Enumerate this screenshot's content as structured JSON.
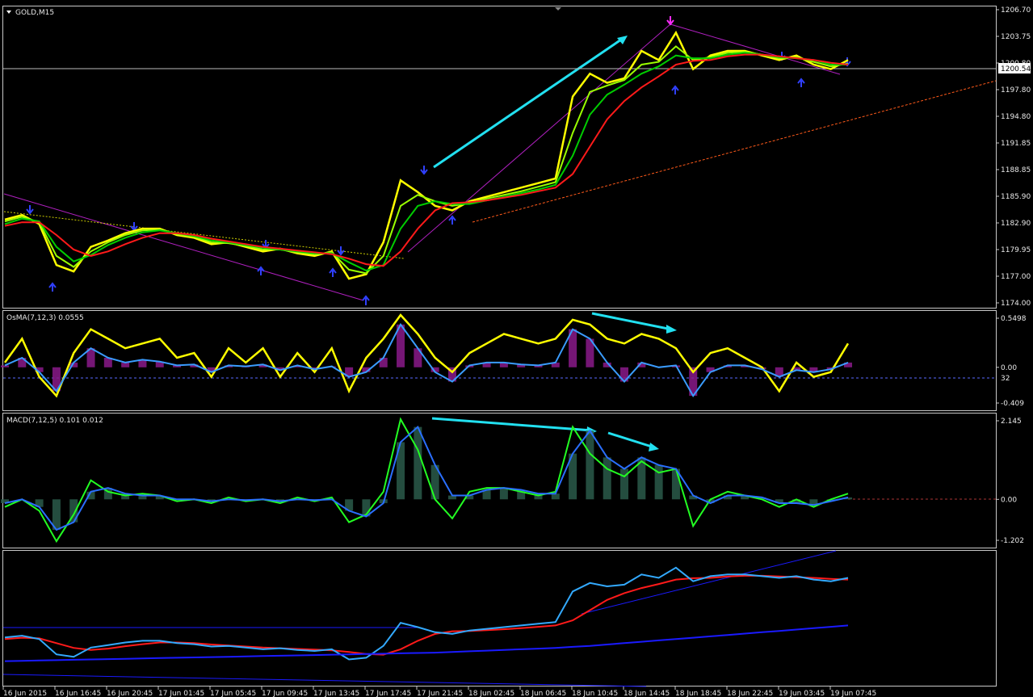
{
  "chart_data": {
    "type": "line",
    "panels": [
      {
        "id": "price",
        "label": "GOLD,M15",
        "ylim": [
          1174.0,
          1206.7
        ],
        "ticks": [
          "1206.70",
          "1203.75",
          "1200.80",
          "1197.80",
          "1194.80",
          "1191.85",
          "1188.85",
          "1185.90",
          "1182.90",
          "1179.95",
          "1177.00",
          "1174.00"
        ],
        "current_price": "1200.54",
        "series": [
          {
            "color": "#ffff00",
            "values": [
              1183.5,
              1184.0,
              1183.0,
              1178.5,
              1177.8,
              1180.5,
              1181.2,
              1182.0,
              1182.5,
              1182.5,
              1181.8,
              1181.5,
              1180.8,
              1181.0,
              1180.5,
              1180.0,
              1180.3,
              1179.8,
              1179.5,
              1180.0,
              1177.0,
              1177.5,
              1181.0,
              1187.8,
              1186.5,
              1185.0,
              1184.5,
              1185.5,
              1186.0,
              1186.5,
              1187.0,
              1187.5,
              1188.0,
              1197.0,
              1199.5,
              1198.5,
              1199.0,
              1202.0,
              1201.0,
              1204.0,
              1200.0,
              1201.5,
              1202.0,
              1202.0,
              1201.5,
              1201.0,
              1201.5,
              1200.5,
              1200.0,
              1201.0
            ]
          },
          {
            "color": "#9aff00",
            "values": [
              1183.3,
              1183.8,
              1183.2,
              1179.5,
              1178.3,
              1180.0,
              1181.0,
              1181.8,
              1182.3,
              1182.4,
              1181.9,
              1181.6,
              1181.0,
              1180.9,
              1180.6,
              1180.2,
              1180.2,
              1179.9,
              1179.7,
              1179.9,
              1178.0,
              1177.6,
              1179.5,
              1185.0,
              1186.2,
              1185.5,
              1185.0,
              1185.3,
              1185.8,
              1186.2,
              1186.6,
              1187.1,
              1187.6,
              1193.0,
              1197.5,
              1198.2,
              1198.8,
              1200.5,
              1200.8,
              1202.5,
              1201.0,
              1201.3,
              1201.8,
              1201.9,
              1201.6,
              1201.2,
              1201.3,
              1200.8,
              1200.3,
              1200.6
            ]
          },
          {
            "color": "#00cc00",
            "values": [
              1183.0,
              1183.6,
              1183.3,
              1180.5,
              1178.9,
              1179.6,
              1180.7,
              1181.5,
              1182.1,
              1182.3,
              1182.0,
              1181.7,
              1181.2,
              1181.0,
              1180.7,
              1180.4,
              1180.2,
              1180.0,
              1179.8,
              1179.8,
              1178.8,
              1177.9,
              1178.5,
              1182.5,
              1185.0,
              1185.5,
              1185.2,
              1185.2,
              1185.6,
              1186.0,
              1186.4,
              1186.8,
              1187.3,
              1190.5,
              1195.0,
              1197.2,
              1198.3,
              1199.5,
              1200.3,
              1201.5,
              1201.2,
              1201.2,
              1201.6,
              1201.8,
              1201.6,
              1201.3,
              1201.2,
              1201.0,
              1200.5,
              1200.5
            ]
          },
          {
            "color": "#ff1a1a",
            "values": [
              1182.8,
              1183.2,
              1183.2,
              1181.8,
              1180.2,
              1179.5,
              1180.0,
              1180.8,
              1181.5,
              1182.0,
              1182.0,
              1181.8,
              1181.4,
              1181.1,
              1180.8,
              1180.5,
              1180.3,
              1180.1,
              1179.9,
              1179.7,
              1179.2,
              1178.6,
              1178.4,
              1180.0,
              1182.5,
              1184.5,
              1185.3,
              1185.4,
              1185.6,
              1185.9,
              1186.2,
              1186.6,
              1187.0,
              1188.5,
              1191.5,
              1194.5,
              1196.5,
              1198.0,
              1199.2,
              1200.5,
              1200.9,
              1201.0,
              1201.4,
              1201.6,
              1201.6,
              1201.4,
              1201.2,
              1201.0,
              1200.7,
              1200.5
            ]
          }
        ]
      },
      {
        "id": "osma",
        "label": "OsMA(7,12,3) 0.0555",
        "ylim": [
          -0.409,
          0.5498
        ],
        "ticks": [
          "0.5498",
          "0.00",
          "-0.409"
        ],
        "level": "32",
        "series": [
          {
            "color": "#ffff00",
            "values": [
              0.05,
              0.3,
              -0.1,
              -0.3,
              0.15,
              0.4,
              0.3,
              0.2,
              0.25,
              0.3,
              0.1,
              0.15,
              -0.1,
              0.2,
              0.05,
              0.2,
              -0.1,
              0.15,
              -0.05,
              0.2,
              -0.25,
              0.1,
              0.3,
              0.55,
              0.35,
              0.1,
              -0.05,
              0.15,
              0.25,
              0.35,
              0.3,
              0.25,
              0.3,
              0.5,
              0.45,
              0.3,
              0.25,
              0.35,
              0.3,
              0.2,
              -0.05,
              0.15,
              0.2,
              0.1,
              0.0,
              -0.25,
              0.05,
              -0.1,
              -0.05,
              0.25
            ]
          },
          {
            "color": "#3a9cff",
            "values": [
              0.02,
              0.1,
              -0.05,
              -0.25,
              0.05,
              0.2,
              0.1,
              0.05,
              0.08,
              0.06,
              0.02,
              0.03,
              -0.05,
              0.02,
              0.01,
              0.03,
              -0.03,
              0.02,
              -0.02,
              0.01,
              -0.1,
              -0.05,
              0.1,
              0.45,
              0.2,
              -0.05,
              -0.15,
              0.02,
              0.05,
              0.05,
              0.03,
              0.02,
              0.05,
              0.4,
              0.3,
              0.05,
              -0.15,
              0.05,
              0.0,
              0.02,
              -0.3,
              -0.05,
              0.02,
              0.02,
              -0.02,
              -0.1,
              -0.03,
              -0.05,
              -0.02,
              0.05
            ]
          }
        ]
      },
      {
        "id": "macd",
        "label": "MACD(7,12,5) 0.101 0.012",
        "ylim": [
          -1.202,
          2.145
        ],
        "ticks": [
          "2.145",
          "0.00",
          "-1.202"
        ],
        "series": [
          {
            "color": "#22ff22",
            "values": [
              -0.2,
              0.0,
              -0.3,
              -1.1,
              -0.4,
              0.5,
              0.2,
              0.1,
              0.15,
              0.1,
              -0.05,
              0.0,
              -0.1,
              0.05,
              -0.05,
              0.0,
              -0.1,
              0.05,
              -0.05,
              0.05,
              -0.6,
              -0.4,
              0.2,
              2.1,
              1.3,
              0.0,
              -0.5,
              0.2,
              0.3,
              0.3,
              0.2,
              0.1,
              0.2,
              1.9,
              1.2,
              0.8,
              0.6,
              1.0,
              0.7,
              0.8,
              -0.7,
              0.0,
              0.2,
              0.1,
              0.0,
              -0.2,
              0.0,
              -0.2,
              0.0,
              0.15
            ]
          },
          {
            "color": "#2a6fff",
            "values": [
              -0.1,
              0.0,
              -0.2,
              -0.8,
              -0.6,
              0.2,
              0.3,
              0.15,
              0.1,
              0.1,
              0.0,
              0.0,
              -0.05,
              0.0,
              -0.02,
              0.0,
              -0.05,
              0.0,
              -0.02,
              0.0,
              -0.3,
              -0.45,
              -0.1,
              1.5,
              1.9,
              0.9,
              0.1,
              0.1,
              0.25,
              0.3,
              0.25,
              0.15,
              0.15,
              1.2,
              1.8,
              1.1,
              0.8,
              1.1,
              0.9,
              0.8,
              0.1,
              -0.1,
              0.1,
              0.1,
              0.05,
              -0.1,
              -0.1,
              -0.15,
              -0.05,
              0.05
            ]
          }
        ]
      },
      {
        "id": "bands",
        "label": "",
        "ylim": [
          1170.0,
          1208.0
        ],
        "ticks": [],
        "series": [
          {
            "color": "#ff1a1a",
            "values": [
              1183.0,
              1183.4,
              1183.2,
              1181.8,
              1180.4,
              1179.8,
              1180.2,
              1180.9,
              1181.5,
              1182.0,
              1182.0,
              1181.8,
              1181.4,
              1181.1,
              1180.8,
              1180.5,
              1180.3,
              1180.1,
              1179.9,
              1179.7,
              1179.2,
              1178.6,
              1178.4,
              1180.0,
              1182.5,
              1184.5,
              1185.3,
              1185.4,
              1185.6,
              1185.9,
              1186.2,
              1186.6,
              1187.0,
              1188.5,
              1191.5,
              1194.5,
              1196.5,
              1198.0,
              1199.2,
              1200.5,
              1200.9,
              1201.0,
              1201.4,
              1201.6,
              1201.6,
              1201.4,
              1201.2,
              1201.0,
              1200.7,
              1200.5
            ]
          },
          {
            "color": "#33aaff",
            "values": [
              1183.5,
              1184.0,
              1183.0,
              1178.5,
              1177.8,
              1180.5,
              1181.2,
              1182.0,
              1182.5,
              1182.5,
              1181.8,
              1181.5,
              1180.8,
              1181.0,
              1180.5,
              1180.0,
              1180.3,
              1179.8,
              1179.5,
              1180.0,
              1177.0,
              1177.5,
              1181.0,
              1187.8,
              1186.5,
              1185.0,
              1184.5,
              1185.5,
              1186.0,
              1186.5,
              1187.0,
              1187.5,
              1188.0,
              1197.0,
              1199.5,
              1198.5,
              1199.0,
              1202.0,
              1201.0,
              1204.0,
              1200.0,
              1201.5,
              1202.0,
              1202.0,
              1201.5,
              1201.0,
              1201.5,
              1200.5,
              1200.0,
              1201.0
            ]
          },
          {
            "color": "#1a1aff",
            "values": [
              1176.5,
              1176.6,
              1176.7,
              1176.8,
              1176.9,
              1177.0,
              1177.1,
              1177.2,
              1177.3,
              1177.4,
              1177.5,
              1177.6,
              1177.7,
              1177.8,
              1177.9,
              1178.0,
              1178.1,
              1178.2,
              1178.3,
              1178.4,
              1178.5,
              1178.6,
              1178.7,
              1178.8,
              1178.9,
              1179.0,
              1179.2,
              1179.4,
              1179.6,
              1179.8,
              1180.0,
              1180.2,
              1180.4,
              1180.7,
              1181.0,
              1181.4,
              1181.8,
              1182.2,
              1182.6,
              1183.0,
              1183.4,
              1183.8,
              1184.2,
              1184.6,
              1185.0,
              1185.4,
              1185.8,
              1186.2,
              1186.6,
              1187.0
            ]
          }
        ]
      }
    ],
    "time_labels": [
      "16 Jun 2015",
      "16 Jun 16:45",
      "16 Jun 20:45",
      "17 Jun 01:45",
      "17 Jun 05:45",
      "17 Jun 09:45",
      "17 Jun 13:45",
      "17 Jun 17:45",
      "17 Jun 21:45",
      "18 Jun 02:45",
      "18 Jun 06:45",
      "18 Jun 10:45",
      "18 Jun 14:45",
      "18 Jun 18:45",
      "18 Jun 22:45",
      "19 Jun 03:45",
      "19 Jun 07:45"
    ]
  }
}
